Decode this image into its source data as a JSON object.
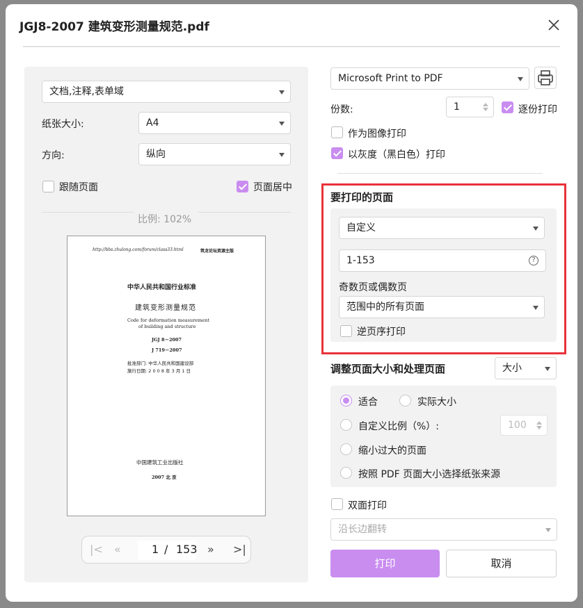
{
  "dialog": {
    "title": "JGJ8-2007 建筑变形测量规范.pdf"
  },
  "left": {
    "content_select": "文档,注释,表单域",
    "paper_size_label": "纸张大小:",
    "paper_size_value": "A4",
    "orientation_label": "方向:",
    "orientation_value": "纵向",
    "follow_page_label": "跟随页面",
    "follow_page_checked": false,
    "center_page_label": "页面居中",
    "center_page_checked": true,
    "scale_text": "比例: 102%"
  },
  "preview": {
    "header_url": "http://bbs.zhulong.com/forum/class33.html",
    "header_right": "筑龙论坛资源主版",
    "standard_title": "中华人民共和国行业标准",
    "doc_title": "建筑变形测量规范",
    "en_title_1": "Code for deformation measurement",
    "en_title_2": "of building and structure",
    "code_1": "JGJ 8－2007",
    "code_2": "J 719－2007",
    "approval": "批准部门: 中华人民共和国建设部",
    "effective": "施行日期: 2 0 0 8 年 3 月 1 日",
    "publisher": "中国建筑工业出版社",
    "city": "2007  北  京"
  },
  "pager": {
    "current": "1",
    "separator": "/",
    "total": "153"
  },
  "right": {
    "printer": "Microsoft Print to PDF",
    "copies_label": "份数:",
    "copies_value": "1",
    "collate_label": "逐份打印",
    "collate_checked": true,
    "print_as_image_label": "作为图像打印",
    "print_as_image_checked": false,
    "grayscale_label": "以灰度（黑白色）打印",
    "grayscale_checked": true,
    "pages_title": "要打印的页面",
    "pages_mode": "自定义",
    "pages_range": "1-153",
    "odd_even_label": "奇数页或偶数页",
    "odd_even_value": "范围中的所有页面",
    "reverse_label": "逆页序打印",
    "reverse_checked": false,
    "sizing_title": "调整页面大小和处理页面",
    "sizing_mode": "大小",
    "fit_label": "适合",
    "actual_size_label": "实际大小",
    "custom_scale_label": "自定义比例（%）:",
    "custom_scale_value": "100",
    "shrink_label": "缩小过大的页面",
    "pdf_source_label": "按照 PDF 页面大小选择纸张来源",
    "duplex_label": "双面打印",
    "duplex_checked": false,
    "flip_value": "沿长边翻转",
    "print_button": "打印",
    "cancel_button": "取消"
  },
  "colors": {
    "accent": "#c98df0",
    "highlight": "#e8323a"
  }
}
